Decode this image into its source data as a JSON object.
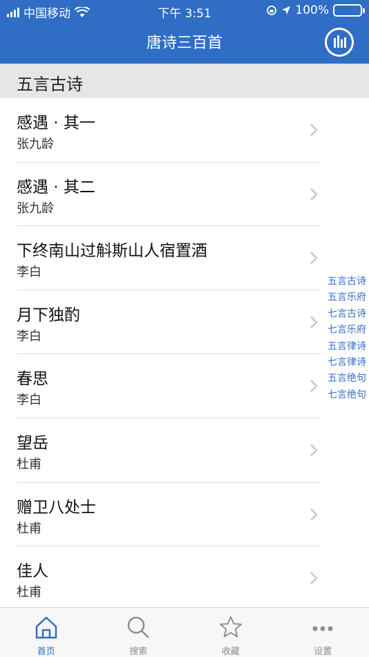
{
  "status_bar": {
    "carrier": "中国移动",
    "time": "下午 3:51",
    "battery": "100%"
  },
  "nav": {
    "title": "唐诗三百首"
  },
  "section": {
    "title": "五言古诗"
  },
  "poems": [
    {
      "title": "感遇 · 其一",
      "author": "张九龄"
    },
    {
      "title": "感遇 · 其二",
      "author": "张九龄"
    },
    {
      "title": "下终南山过斛斯山人宿置酒",
      "author": "李白"
    },
    {
      "title": "月下独酌",
      "author": "李白"
    },
    {
      "title": "春思",
      "author": "李白"
    },
    {
      "title": "望岳",
      "author": "杜甫"
    },
    {
      "title": "赠卫八处士",
      "author": "杜甫"
    },
    {
      "title": "佳人",
      "author": "杜甫"
    }
  ],
  "index_items": [
    "五言古诗",
    "五言乐府",
    "七言古诗",
    "七言乐府",
    "五言律诗",
    "七言律诗",
    "五言绝句",
    "七言绝句"
  ],
  "tabs": [
    {
      "label": "首页",
      "icon": "home-icon"
    },
    {
      "label": "搜索",
      "icon": "search-icon"
    },
    {
      "label": "收藏",
      "icon": "star-icon"
    },
    {
      "label": "设置",
      "icon": "more-icon"
    }
  ],
  "colors": {
    "accent": "#2f6ec4",
    "section_bg": "#e6e6e6",
    "tab_inactive": "#8e8e8e"
  }
}
